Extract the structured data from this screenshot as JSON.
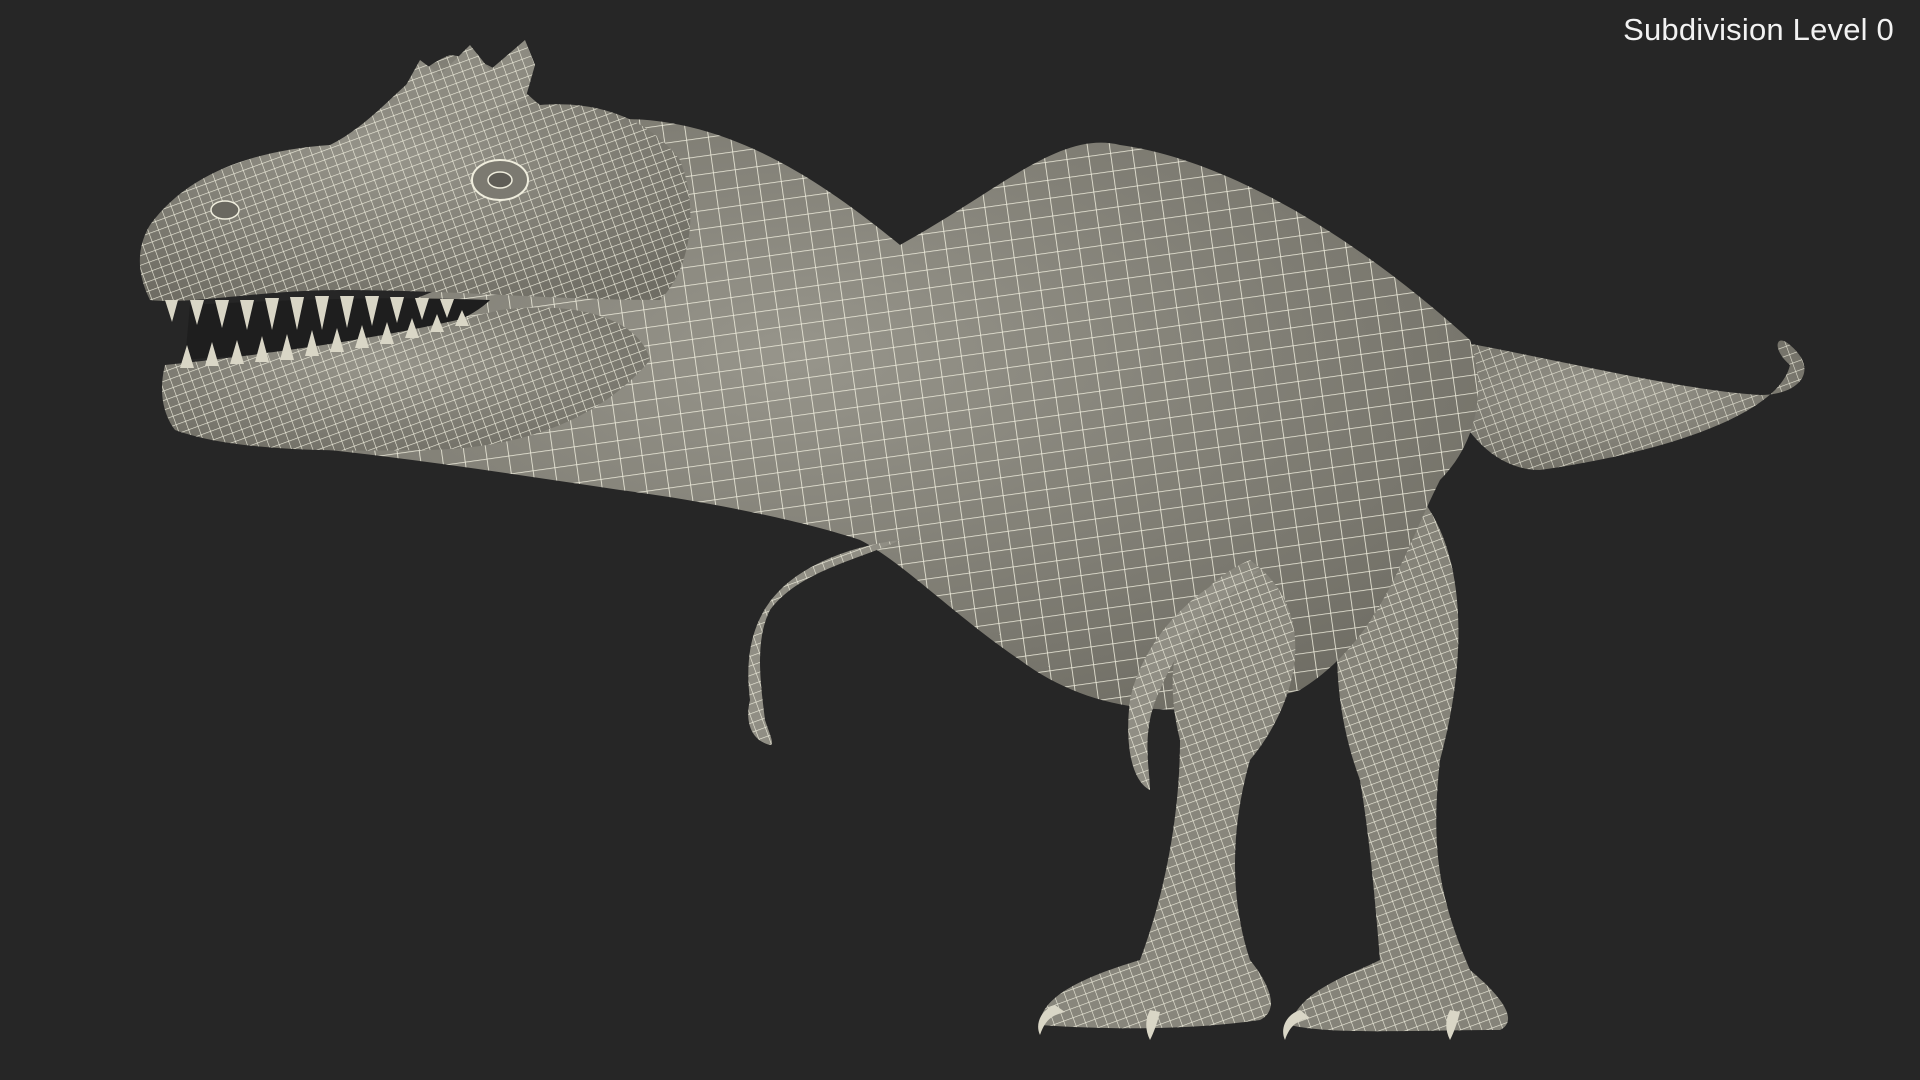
{
  "viewport": {
    "subdivision_label": "Subdivision Level 0",
    "background_color": "#262626",
    "mesh_fill_color": "#8c8a80",
    "wire_color": "#f4f2e4"
  }
}
